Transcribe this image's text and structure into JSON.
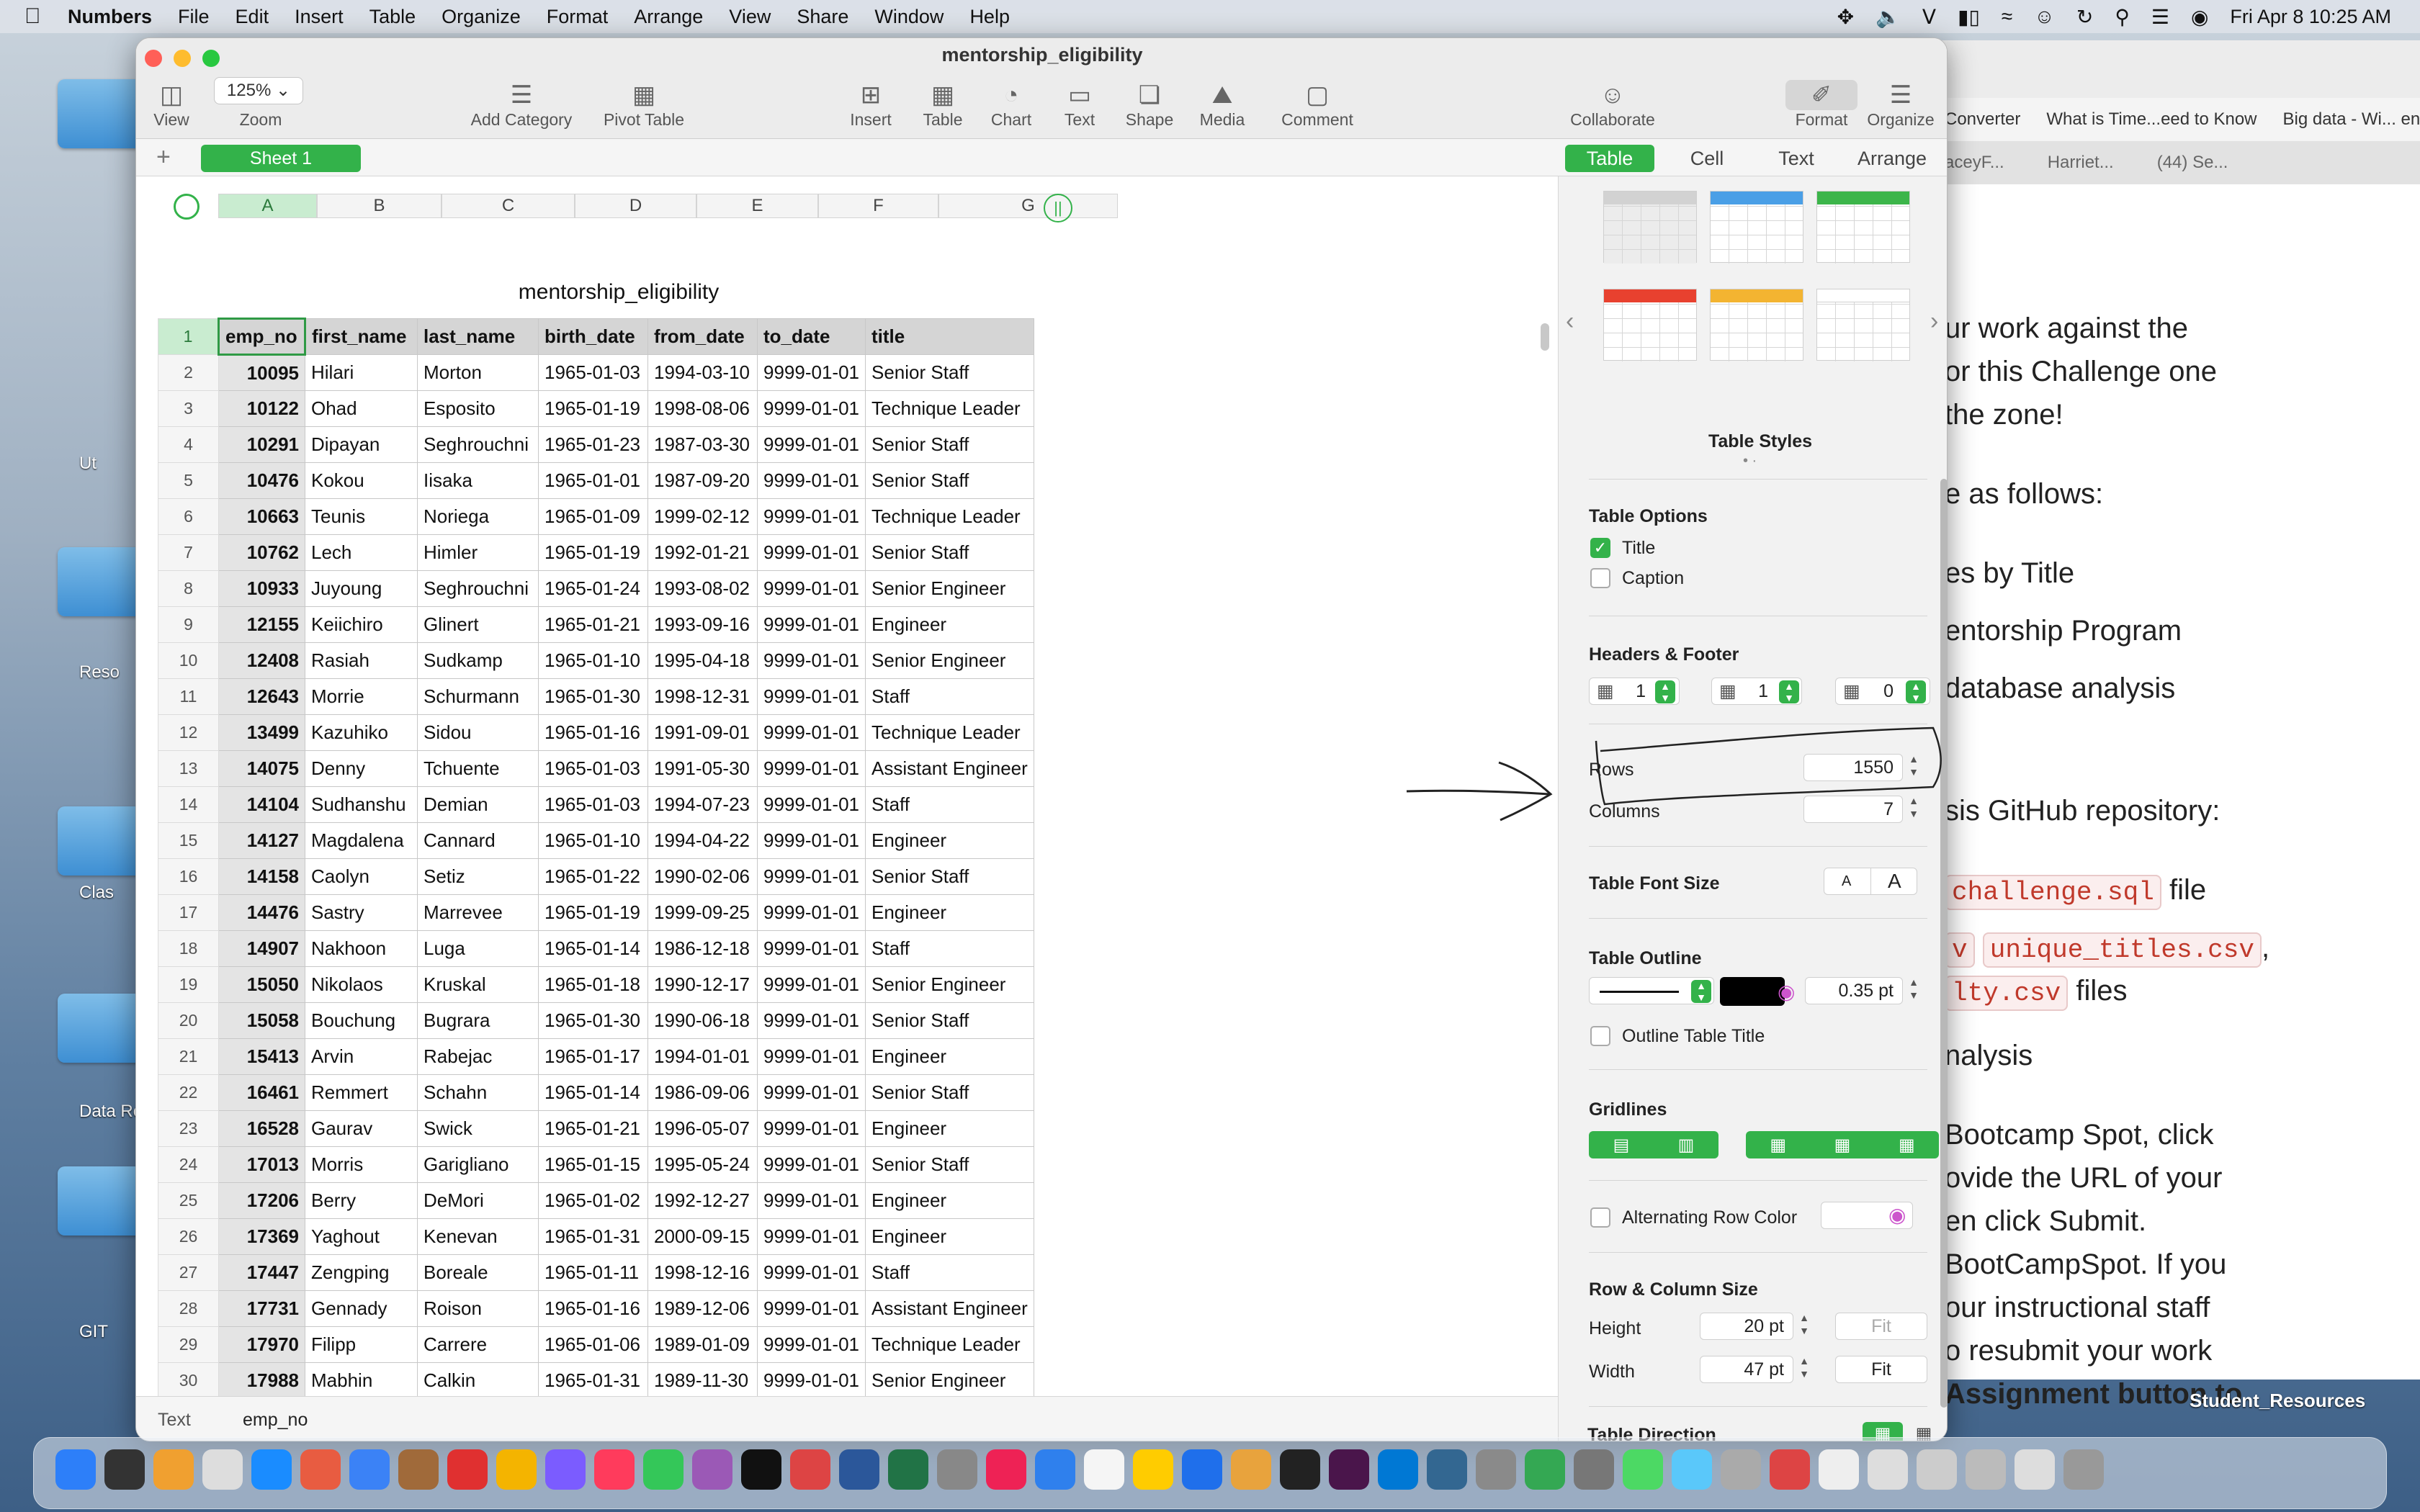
{
  "menubar": {
    "app_name": "Numbers",
    "menus": [
      "File",
      "Edit",
      "Insert",
      "Table",
      "Organize",
      "Format",
      "Arrange",
      "View",
      "Share",
      "Window",
      "Help"
    ],
    "datetime": "Fri Apr 8  10:25 AM"
  },
  "window": {
    "title": "mentorship_eligibility",
    "zoom_value": "125%",
    "toolbar": {
      "view": "View",
      "zoom": "Zoom",
      "add_category": "Add Category",
      "pivot_table": "Pivot Table",
      "insert": "Insert",
      "table": "Table",
      "chart": "Chart",
      "text": "Text",
      "shape": "Shape",
      "media": "Media",
      "comment": "Comment",
      "collaborate": "Collaborate",
      "format": "Format",
      "organize": "Organize"
    },
    "sheet_tab": "Sheet 1",
    "inspector_tabs": [
      "Table",
      "Cell",
      "Text",
      "Arrange"
    ],
    "active_inspector_tab": "Table"
  },
  "table": {
    "title": "mentorship_eligibility",
    "column_letters": [
      "A",
      "B",
      "C",
      "D",
      "E",
      "F",
      "G"
    ],
    "headers": [
      "emp_no",
      "first_name",
      "last_name",
      "birth_date",
      "from_date",
      "to_date",
      "title"
    ],
    "rows": [
      [
        "10095",
        "Hilari",
        "Morton",
        "1965-01-03",
        "1994-03-10",
        "9999-01-01",
        "Senior Staff"
      ],
      [
        "10122",
        "Ohad",
        "Esposito",
        "1965-01-19",
        "1998-08-06",
        "9999-01-01",
        "Technique Leader"
      ],
      [
        "10291",
        "Dipayan",
        "Seghrouchni",
        "1965-01-23",
        "1987-03-30",
        "9999-01-01",
        "Senior Staff"
      ],
      [
        "10476",
        "Kokou",
        "Iisaka",
        "1965-01-01",
        "1987-09-20",
        "9999-01-01",
        "Senior Staff"
      ],
      [
        "10663",
        "Teunis",
        "Noriega",
        "1965-01-09",
        "1999-02-12",
        "9999-01-01",
        "Technique Leader"
      ],
      [
        "10762",
        "Lech",
        "Himler",
        "1965-01-19",
        "1992-01-21",
        "9999-01-01",
        "Senior Staff"
      ],
      [
        "10933",
        "Juyoung",
        "Seghrouchni",
        "1965-01-24",
        "1993-08-02",
        "9999-01-01",
        "Senior Engineer"
      ],
      [
        "12155",
        "Keiichiro",
        "Glinert",
        "1965-01-21",
        "1993-09-16",
        "9999-01-01",
        "Engineer"
      ],
      [
        "12408",
        "Rasiah",
        "Sudkamp",
        "1965-01-10",
        "1995-04-18",
        "9999-01-01",
        "Senior Engineer"
      ],
      [
        "12643",
        "Morrie",
        "Schurmann",
        "1965-01-30",
        "1998-12-31",
        "9999-01-01",
        "Staff"
      ],
      [
        "13499",
        "Kazuhiko",
        "Sidou",
        "1965-01-16",
        "1991-09-01",
        "9999-01-01",
        "Technique Leader"
      ],
      [
        "14075",
        "Denny",
        "Tchuente",
        "1965-01-03",
        "1991-05-30",
        "9999-01-01",
        "Assistant Engineer"
      ],
      [
        "14104",
        "Sudhanshu",
        "Demian",
        "1965-01-03",
        "1994-07-23",
        "9999-01-01",
        "Staff"
      ],
      [
        "14127",
        "Magdalena",
        "Cannard",
        "1965-01-10",
        "1994-04-22",
        "9999-01-01",
        "Engineer"
      ],
      [
        "14158",
        "Caolyn",
        "Setiz",
        "1965-01-22",
        "1990-02-06",
        "9999-01-01",
        "Senior Staff"
      ],
      [
        "14476",
        "Sastry",
        "Marrevee",
        "1965-01-19",
        "1999-09-25",
        "9999-01-01",
        "Engineer"
      ],
      [
        "14907",
        "Nakhoon",
        "Luga",
        "1965-01-14",
        "1986-12-18",
        "9999-01-01",
        "Staff"
      ],
      [
        "15050",
        "Nikolaos",
        "Kruskal",
        "1965-01-18",
        "1990-12-17",
        "9999-01-01",
        "Senior Engineer"
      ],
      [
        "15058",
        "Bouchung",
        "Bugrara",
        "1965-01-30",
        "1990-06-18",
        "9999-01-01",
        "Senior Staff"
      ],
      [
        "15413",
        "Arvin",
        "Rabejac",
        "1965-01-17",
        "1994-01-01",
        "9999-01-01",
        "Engineer"
      ],
      [
        "16461",
        "Remmert",
        "Schahn",
        "1965-01-14",
        "1986-09-06",
        "9999-01-01",
        "Senior Staff"
      ],
      [
        "16528",
        "Gaurav",
        "Swick",
        "1965-01-21",
        "1996-05-07",
        "9999-01-01",
        "Engineer"
      ],
      [
        "17013",
        "Morris",
        "Garigliano",
        "1965-01-15",
        "1995-05-24",
        "9999-01-01",
        "Senior Staff"
      ],
      [
        "17206",
        "Berry",
        "DeMori",
        "1965-01-02",
        "1992-12-27",
        "9999-01-01",
        "Engineer"
      ],
      [
        "17369",
        "Yaghout",
        "Kenevan",
        "1965-01-31",
        "2000-09-15",
        "9999-01-01",
        "Engineer"
      ],
      [
        "17447",
        "Zengping",
        "Boreale",
        "1965-01-11",
        "1998-12-16",
        "9999-01-01",
        "Staff"
      ],
      [
        "17731",
        "Gennady",
        "Roison",
        "1965-01-16",
        "1989-12-06",
        "9999-01-01",
        "Assistant Engineer"
      ],
      [
        "17970",
        "Filipp",
        "Carrere",
        "1965-01-06",
        "1989-01-09",
        "9999-01-01",
        "Technique Leader"
      ],
      [
        "17988",
        "Mabhin",
        "Calkin",
        "1965-01-31",
        "1989-11-30",
        "9999-01-01",
        "Senior Engineer"
      ]
    ]
  },
  "sidebar": {
    "table_styles_label": "Table Styles",
    "table_style_header_colors": [
      "#d2d2d2",
      "#4a9fe6",
      "#3cb54a",
      "#e8412f",
      "#f3b431",
      "#ffffff"
    ],
    "table_options": {
      "title": "Table Options",
      "title_label": "Title",
      "title_checked": true,
      "caption_label": "Caption",
      "caption_checked": false
    },
    "headers_footer": {
      "title": "Headers & Footer",
      "header_rows": "1",
      "header_columns": "1",
      "footer_rows": "0"
    },
    "rows_label": "Rows",
    "rows_value": "1550",
    "columns_label": "Columns",
    "columns_value": "7",
    "font_size_label": "Table Font Size",
    "font_small": "A",
    "font_large": "A",
    "outline": {
      "title": "Table Outline",
      "width": "0.35 pt",
      "color": "#000000",
      "outline_title_label": "Outline Table Title"
    },
    "gridlines_label": "Gridlines",
    "alt_row_label": "Alternating Row Color",
    "row_col_size": {
      "title": "Row & Column Size",
      "height_label": "Height",
      "height_value": "20 pt",
      "width_label": "Width",
      "width_value": "47 pt",
      "fit": "Fit"
    },
    "direction_label": "Table Direction"
  },
  "footer": {
    "left": "Text",
    "cell_ref": "emp_no"
  },
  "background_browser": {
    "bookmarks": [
      "Converter",
      "What is Time...eed to Know",
      "Big data - Wi... ency"
    ],
    "tabs": [
      "aceyF...",
      "Harriet...",
      "(44) Se..."
    ],
    "lines": [
      {
        "text": "ur work against the"
      },
      {
        "text": "or this Challenge one"
      },
      {
        "text": " the zone!"
      },
      {
        "text": "e as follows:"
      },
      {
        "text": "es by Title"
      },
      {
        "text": "entorship Program"
      },
      {
        "text": "database analysis"
      },
      {
        "text": "sis GitHub repository:"
      },
      {
        "text": "file",
        "code": "challenge.sql"
      },
      {
        "text": ",",
        "code": "v",
        "code2": "unique_titles.csv"
      },
      {
        "text": "files",
        "code": "lty.csv"
      },
      {
        "text": "nalysis"
      },
      {
        "text": "Bootcamp Spot, click"
      },
      {
        "text": "ovide the URL of your"
      },
      {
        "text": "en click Submit."
      },
      {
        "text": "BootCampSpot. If you"
      },
      {
        "text": "our instructional staff"
      },
      {
        "text": "o resubmit your work"
      },
      {
        "text": "Assignment button to",
        "bold_prefix": "Assignment"
      }
    ],
    "desktop_label": "Student_Resources"
  },
  "desktop_labels": [
    "Ut",
    "Reso",
    "Clas",
    "Data Res",
    "GIT"
  ]
}
